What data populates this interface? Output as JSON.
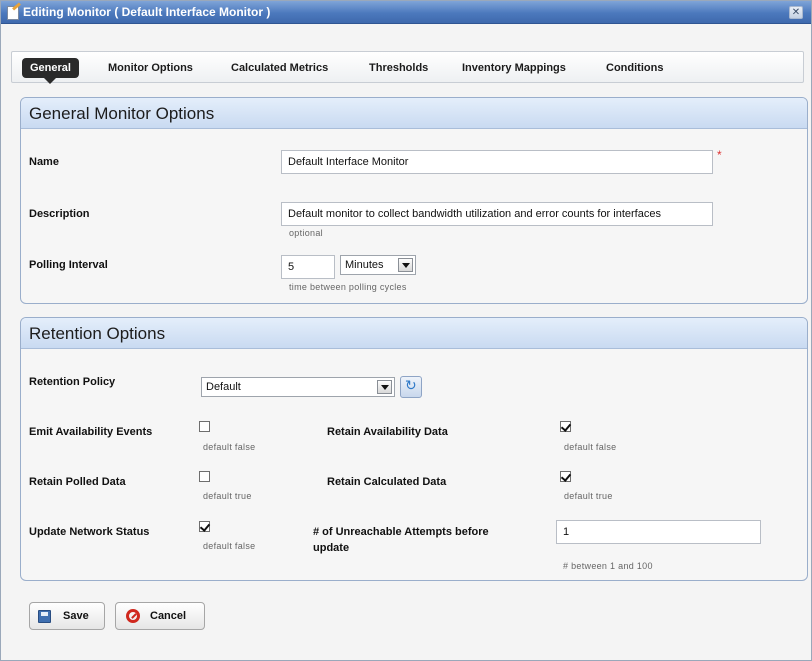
{
  "window": {
    "title": "Editing Monitor ( Default Interface Monitor )",
    "close_symbol": "✕"
  },
  "tabs": [
    {
      "label": "General",
      "active": true
    },
    {
      "label": "Monitor Options"
    },
    {
      "label": "Calculated Metrics"
    },
    {
      "label": "Thresholds"
    },
    {
      "label": "Inventory Mappings"
    },
    {
      "label": "Conditions"
    }
  ],
  "general": {
    "header": "General Monitor Options",
    "name_label": "Name",
    "name_value": "Default Interface Monitor",
    "required_symbol": "*",
    "description_label": "Description",
    "description_value": "Default monitor to collect bandwidth utilization and error counts for interfaces",
    "description_hint": "optional",
    "polling_label": "Polling Interval",
    "polling_value": "5",
    "polling_unit": "Minutes",
    "polling_hint": "time between polling cycles"
  },
  "retention": {
    "header": "Retention Options",
    "policy_label": "Retention Policy",
    "policy_value": "Default",
    "emit_availability_label": "Emit Availability Events",
    "emit_availability_checked": false,
    "emit_availability_hint": "default false",
    "retain_availability_label": "Retain Availability Data",
    "retain_availability_checked": true,
    "retain_availability_hint": "default false",
    "retain_polled_label": "Retain Polled Data",
    "retain_polled_checked": false,
    "retain_polled_hint": "default true",
    "retain_calculated_label": "Retain Calculated Data",
    "retain_calculated_checked": true,
    "retain_calculated_hint": "default true",
    "update_status_label": "Update Network Status",
    "update_status_checked": true,
    "update_status_hint": "default false",
    "unreachable_label_line1": "# of Unreachable Attempts before",
    "unreachable_label_line2": "update",
    "unreachable_value": "1",
    "unreachable_hint": "# between 1 and 100"
  },
  "buttons": {
    "save": "Save",
    "cancel": "Cancel"
  },
  "colors": {
    "titlebar": "#4c79bd",
    "panel_header": "#c9daf1",
    "active_tab": "#2a2a2a",
    "cancel_icon": "#d0281e",
    "save_icon": "#3f6fb0"
  }
}
